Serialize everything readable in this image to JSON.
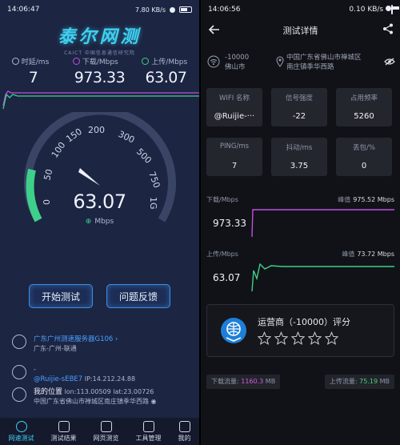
{
  "left": {
    "status": {
      "time": "14:06:47",
      "network": "7.80 KB/s"
    },
    "logo": {
      "title": "泰尔网测",
      "subtitle": "CAICT 中国信息通信研究院"
    },
    "metrics": [
      {
        "label": "时延/ms",
        "value": "7"
      },
      {
        "label": "下载/Mbps",
        "value": "973.33"
      },
      {
        "label": "上传/Mbps",
        "value": "63.07"
      }
    ],
    "gauge": {
      "ticks": [
        "0",
        "50",
        "100",
        "150",
        "200",
        "300",
        "500",
        "750",
        "1G"
      ],
      "value": "63.07",
      "unit": "Mbps"
    },
    "buttons": {
      "start": "开始测试",
      "feedback": "问题反馈"
    },
    "server": {
      "name": "广东广州测速服务器G106",
      "detail": "广东-广州-联通"
    },
    "wifi": {
      "status": "-",
      "ssid": "@Ruijie-sEBE7",
      "ip": "IP:14.212.24.88"
    },
    "location": {
      "title": "我的位置",
      "coords": "lon:113.00509  lat:23.00726",
      "address": "中国广东省佛山市禅城区南庄镇季华西路"
    },
    "nav": [
      {
        "label": "网速测试"
      },
      {
        "label": "测试结果"
      },
      {
        "label": "网页测览"
      },
      {
        "label": "工具管理"
      },
      {
        "label": "我的"
      }
    ]
  },
  "right": {
    "status": {
      "time": "14:06:56",
      "network": "0.10 KB/s"
    },
    "title": "测试详情",
    "isp": {
      "line1": "-10000",
      "line2": "佛山市"
    },
    "address": {
      "line1": "中国广东省佛山市禅城区",
      "line2": "南庄镇季华西路"
    },
    "cards": [
      {
        "label": "WIFI 名称",
        "value": "@Ruijie-···"
      },
      {
        "label": "信号强度",
        "value": "-22"
      },
      {
        "label": "占用频率",
        "value": "5260"
      },
      {
        "label": "PING/ms",
        "value": "7"
      },
      {
        "label": "抖动/ms",
        "value": "3.75"
      },
      {
        "label": "丢包/%",
        "value": "0"
      }
    ],
    "download": {
      "label": "下载/Mbps",
      "peak_label": "峰值",
      "peak": "975.52 Mbps",
      "value": "973.33"
    },
    "upload": {
      "label": "上传/Mbps",
      "peak_label": "峰值",
      "peak": "73.72 Mbps",
      "value": "63.07"
    },
    "isp_rating": {
      "title": "运营商（-10000）评分",
      "stars": 0,
      "max_stars": 5
    },
    "traffic": {
      "down_label": "下载流量:",
      "down_value": "1160.3",
      "down_unit": "MB",
      "up_label": "上传流量:",
      "up_value": "75.19",
      "up_unit": "MB"
    }
  },
  "colors": {
    "left_bg": "#1c2542",
    "right_bg": "#111217",
    "accent_cyan": "#3fd0f0",
    "download_purple": "#c04fe0",
    "upload_green": "#3ed08a",
    "button_border": "#3d8ee8"
  }
}
